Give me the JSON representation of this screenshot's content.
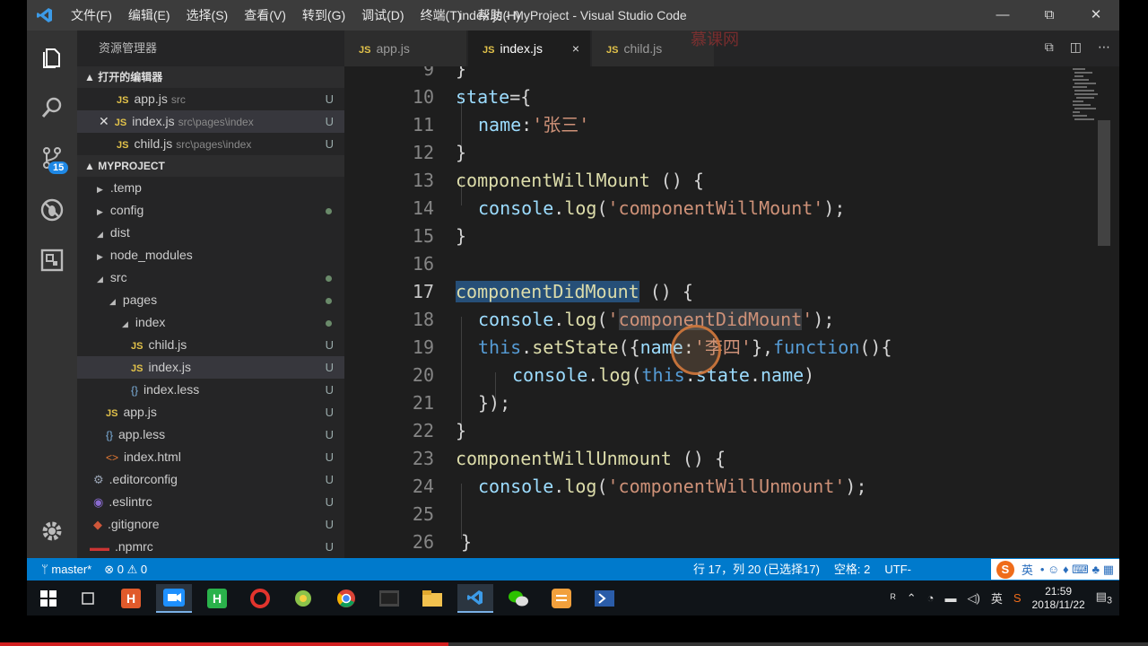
{
  "titlebar": {
    "menus": [
      "文件(F)",
      "编辑(E)",
      "选择(S)",
      "查看(V)",
      "转到(G)",
      "调试(D)",
      "终端(T)",
      "帮助(H)"
    ],
    "title": "index.js - MyProject - Visual Studio Code",
    "controls": [
      "—",
      "⧉",
      "✕"
    ]
  },
  "activity": {
    "scm_badge": "15"
  },
  "sidebar": {
    "title": "资源管理器",
    "open_editors_header": "▲ 打开的编辑器",
    "open_editors": [
      {
        "name": "app.js",
        "path": "src",
        "status": "U"
      },
      {
        "name": "index.js",
        "path": "src\\pages\\index",
        "status": "U"
      },
      {
        "name": "child.js",
        "path": "src\\pages\\index",
        "status": "U"
      }
    ],
    "project_header": "▲ MYPROJECT",
    "tree": [
      {
        "label": ".temp",
        "status": ""
      },
      {
        "label": "config",
        "status": "dot"
      },
      {
        "label": "dist",
        "status": ""
      },
      {
        "label": "node_modules",
        "status": ""
      },
      {
        "label": "src",
        "status": "dot"
      },
      {
        "label": "pages",
        "status": "dot"
      },
      {
        "label": "index",
        "status": "dot"
      },
      {
        "label": "child.js",
        "status": "U"
      },
      {
        "label": "index.js",
        "status": "U"
      },
      {
        "label": "index.less",
        "status": "U"
      },
      {
        "label": "app.js",
        "status": "U"
      },
      {
        "label": "app.less",
        "status": "U"
      },
      {
        "label": "index.html",
        "status": "U"
      },
      {
        "label": ".editorconfig",
        "status": "U"
      },
      {
        "label": ".eslintrc",
        "status": "U"
      },
      {
        "label": ".gitignore",
        "status": "U"
      },
      {
        "label": ".npmrc",
        "status": "U"
      }
    ]
  },
  "tabs": [
    {
      "label": "app.js"
    },
    {
      "label": "index.js"
    },
    {
      "label": "child.js"
    }
  ],
  "tab_close": "×",
  "editor": {
    "line_numbers": [
      "9",
      "10",
      "11",
      "12",
      "13",
      "14",
      "15",
      "16",
      "17",
      "18",
      "19",
      "20",
      "21",
      "22",
      "23",
      "24",
      "25",
      "26"
    ],
    "t": {
      "l9": "}",
      "l10a": "state",
      "l10b": "={",
      "l11a": "name",
      "l11b": ":",
      "l11c": "'张三'",
      "l12": "}",
      "l13a": "componentWillMount",
      "l13b": " () {",
      "l14a": "console",
      "l14b": ".",
      "l14c": "log",
      "l14d": "(",
      "l14e": "'componentWillMount'",
      "l14f": ");",
      "l15": "}",
      "l17a": "componentDidMount",
      "l17b": " () {",
      "l18a": "console",
      "l18b": ".",
      "l18c": "log",
      "l18d": "(",
      "l18e": "'",
      "l18f": "componentDidMount",
      "l18g": "'",
      "l18h": ");",
      "l19a": "this",
      "l19b": ".",
      "l19c": "setState",
      "l19d": "({",
      "l19e": "name",
      "l19f": ":",
      "l19g": "'李四'",
      "l19h": "},",
      "l19i": "function",
      "l19j": "(){",
      "l20a": "console",
      "l20b": ".",
      "l20c": "log",
      "l20d": "(",
      "l20e": "this",
      "l20f": ".",
      "l20g": "state",
      "l20h": ".",
      "l20i": "name",
      "l20j": ")",
      "l21": "});",
      "l22": "}",
      "l23a": "componentWillUnmount",
      "l23b": " () {",
      "l24a": "console",
      "l24b": ".",
      "l24c": "log",
      "l24d": "(",
      "l24e": "'componentWillUnmount'",
      "l24f": ");",
      "l26": "}"
    }
  },
  "watermark": "慕课网",
  "statusbar": {
    "branch": "master*",
    "problems": "⊗ 0 ⚠ 0",
    "position": "行 17，列 20 (已选择17)",
    "spaces": "空格: 2",
    "encoding": "UTF-",
    "ime_s": "S",
    "ime_lang": "英",
    "ime_icons": "• ☺ ♦ ⌨ ♣ ▦"
  },
  "taskbar": {
    "tray_lang": "英",
    "time": "21:59",
    "date": "2018/11/22",
    "notif_count": "3"
  },
  "colors": {
    "accent": "#007acc",
    "keyword": "#569cd6",
    "function": "#dcdcaa",
    "string": "#ce9178",
    "identifier": "#9cdcfe",
    "selection": "#264f78"
  }
}
